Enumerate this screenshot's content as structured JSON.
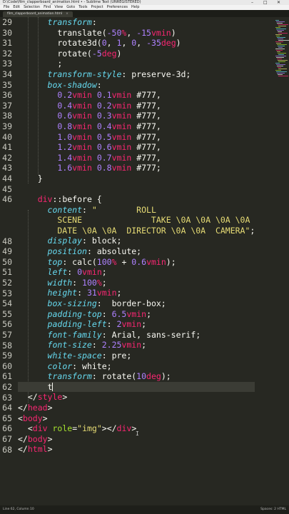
{
  "window": {
    "title": "D:\\Code\\film_clapperboard_animation.html • - Sublime Text (UNREGISTERED)",
    "controls": [
      "–",
      "□",
      "✕"
    ]
  },
  "menu": [
    "File",
    "Edit",
    "Selection",
    "Find",
    "View",
    "Goto",
    "Tools",
    "Project",
    "Preferences",
    "Help"
  ],
  "tab": {
    "label": "film_clapperboard_animation.html",
    "close": "×"
  },
  "editor": {
    "line_numbers": [
      "29",
      "30",
      "31",
      "32",
      "33",
      "34",
      "35",
      "36",
      "37",
      "38",
      "39",
      "40",
      "41",
      "42",
      "43",
      "44",
      "45",
      "46",
      "",
      "",
      "48",
      "49",
      "50",
      "51",
      "52",
      "53",
      "54",
      "55",
      "56",
      "57",
      "58",
      "59",
      "60",
      "61",
      "62",
      "63",
      "64",
      "65",
      "66",
      "67",
      "68"
    ],
    "current_line": "62"
  },
  "status": {
    "left": "Line 62, Column 10",
    "right": "Spaces: 2    HTML"
  },
  "colors": {
    "background": "#272822",
    "property": "#66d9ef",
    "number": "#ae81ff",
    "unit": "#f92672",
    "string": "#e6db74",
    "tag": "#f92672"
  }
}
